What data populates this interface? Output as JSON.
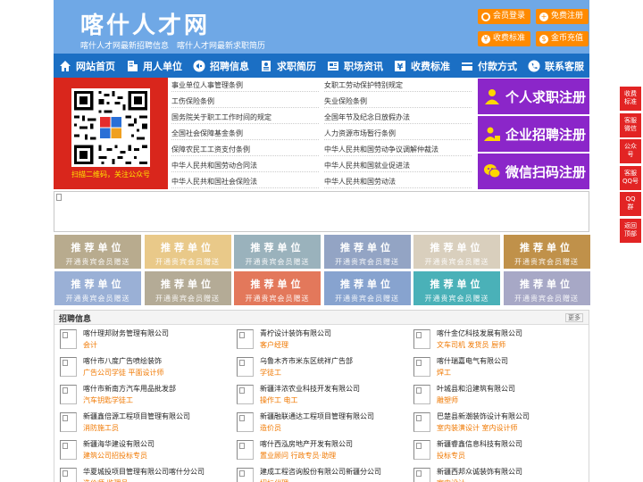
{
  "header": {
    "site_name": "喀什人才网",
    "subtitle": "喀什人才网最新招聘信息　喀什人才网最新求职简历",
    "buttons": [
      {
        "label": "会员登录",
        "icon": "user-icon",
        "color": "#ff8a00"
      },
      {
        "label": "免费注册",
        "icon": "user-add-icon",
        "color": "#ff8a00"
      },
      {
        "label": "收费标准",
        "icon": "yen-icon",
        "color": "#ff8a00"
      },
      {
        "label": "金币充值",
        "icon": "coin-icon",
        "color": "#ff8a00"
      }
    ]
  },
  "nav": {
    "items": [
      {
        "label": "网站首页",
        "icon": "home-icon"
      },
      {
        "label": "用人单位",
        "icon": "building-icon"
      },
      {
        "label": "招聘信息",
        "icon": "megaphone-icon"
      },
      {
        "label": "求职简历",
        "icon": "resume-icon"
      },
      {
        "label": "职场资讯",
        "icon": "news-icon"
      },
      {
        "label": "收费标准",
        "icon": "yen-icon"
      },
      {
        "label": "付款方式",
        "icon": "card-icon"
      },
      {
        "label": "联系客服",
        "icon": "phone-icon"
      }
    ]
  },
  "qr": {
    "caption": "扫描二维码，关注公众号"
  },
  "law_links": {
    "left": [
      "事业单位人事管理条例",
      "工伤保险条例",
      "国务院关于职工工作时间的规定",
      "全国社会保障基金条例",
      "保障农民工工资支付条例",
      "中华人民共和国劳动合同法",
      "中华人民共和国社会保险法"
    ],
    "right": [
      "女职工劳动保护特别规定",
      "失业保险条例",
      "全国年节及纪念日放假办法",
      "人力资源市场暂行条例",
      "中华人民共和国劳动争议调解仲裁法",
      "中华人民共和国就业促进法",
      "中华人民共和国劳动法"
    ]
  },
  "register": [
    {
      "label": "个人求职注册",
      "icon": "person-icon"
    },
    {
      "label": "企业招聘注册",
      "icon": "company-icon"
    },
    {
      "label": "微信扫码注册",
      "icon": "wechat-icon"
    }
  ],
  "tiles": {
    "title": "推荐单位",
    "sub": "开通贵宾会员赠送",
    "colors": [
      "#b8ab8e",
      "#e9c989",
      "#9ab2bc",
      "#93a4c4",
      "#d9cfbd",
      "#c0914a",
      "#9ab0d6",
      "#b4ab96",
      "#e3785b",
      "#87a3cf",
      "#4ab1b8",
      "#a7a8c6"
    ]
  },
  "jobs": {
    "title": "招聘信息",
    "more": "更多",
    "items": [
      {
        "company": "喀什理邦财务管理有限公司",
        "positions": "会计"
      },
      {
        "company": "青柠设计装饰有限公司",
        "positions": "客户经理"
      },
      {
        "company": "喀什金亿科技发展有限公司",
        "positions": "文车司机 发货员 厨师"
      },
      {
        "company": "喀什市八度广告喷绘装饰",
        "positions": "广告公司学徒 平面设计师"
      },
      {
        "company": "乌鲁木齐市米东区统祥广告部",
        "positions": "学徒工"
      },
      {
        "company": "喀什瑞嘉电气有限公司",
        "positions": "焊工"
      },
      {
        "company": "喀什市新南方汽车用品批发部",
        "positions": "汽车钥匙学徒工"
      },
      {
        "company": "新疆沣浓农业科技开发有限公司",
        "positions": "操作工 电工"
      },
      {
        "company": "叶城县和沿建筑有限公司",
        "positions": "雕塑师"
      },
      {
        "company": "新疆鑫倍源工程项目管理有限公司",
        "positions": "消防施工员"
      },
      {
        "company": "新疆融联通达工程项目管理有限公司",
        "positions": "造价员"
      },
      {
        "company": "巴楚县新潮装饰设计有限公司",
        "positions": "室内装潢设计 室内设计师"
      },
      {
        "company": "新疆海华建设有限公司",
        "positions": "建筑公司招投标专员"
      },
      {
        "company": "喀什西泓房地产开发有限公司",
        "positions": "置业顾问 行政专员·助理"
      },
      {
        "company": "新疆睿鑫信息科技有限公司",
        "positions": "投标专员"
      },
      {
        "company": "华夏城投项目管理有限公司喀什分公司",
        "positions": "造价师 监理员"
      },
      {
        "company": "建成工程咨询股份有限公司新疆分公司",
        "positions": "招标代理"
      },
      {
        "company": "新疆西邦众诚装饰有限公司",
        "positions": "室内设计"
      }
    ]
  },
  "side_buttons": [
    "收费标准",
    "客服微信",
    "公众号",
    "客服QQ号",
    "QQ群",
    "返回顶部"
  ],
  "colors": {
    "header_bg": "#6fa8e6",
    "nav_bg": "#1b6fc4",
    "accent_orange": "#ff8a00",
    "register_purple": "#8b26c9",
    "side_red": "#e22424"
  }
}
